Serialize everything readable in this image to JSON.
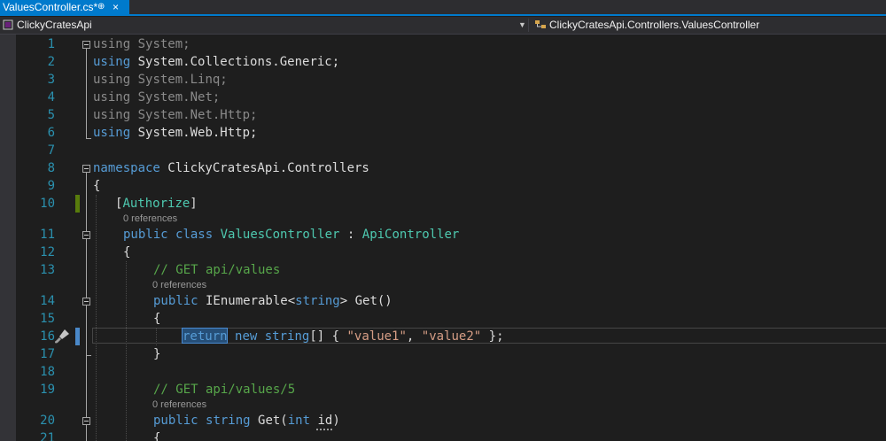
{
  "tab": {
    "title": "ValuesController.cs*",
    "pin": "⊕",
    "close": "×"
  },
  "navbar": {
    "project": "ClickyCratesApi",
    "type": "ClickyCratesApi.Controllers.ValuesController",
    "project_icon": "csharp-project-icon",
    "type_icon": "class-icon"
  },
  "colors": {
    "accent": "#007acc",
    "keyword": "#569cd6",
    "type": "#4ec9b0",
    "string": "#d69d85",
    "comment": "#57a64a",
    "line_number": "#2b91af"
  },
  "editor": {
    "line_numbers": [
      "1",
      "2",
      "3",
      "4",
      "5",
      "6",
      "7",
      "8",
      "9",
      "10",
      "11",
      "12",
      "13",
      "14",
      "15",
      "16",
      "17",
      "18",
      "19",
      "20",
      "21"
    ],
    "codelens": "0 references",
    "lines": {
      "l1": {
        "k": "using",
        "r": " System;"
      },
      "l2": {
        "k": "using",
        "r": " System.Collections.Generic;"
      },
      "l3": {
        "k": "using",
        "r": " System.Linq;"
      },
      "l4": {
        "k": "using",
        "r": " System.Net;"
      },
      "l5": {
        "k": "using",
        "r": " System.Net.Http;"
      },
      "l6": {
        "k": "using",
        "r": " System.Web.Http;"
      },
      "l8": {
        "k": "namespace",
        "r": " ClickyCratesApi.Controllers"
      },
      "l9": {
        "t": "{"
      },
      "l10": {
        "a": "[",
        "b": "Authorize",
        "c": "]"
      },
      "l11": {
        "a": "public",
        "b": " ",
        "c": "class",
        "d": " ",
        "e": "ValuesController",
        "f": " : ",
        "g": "ApiController"
      },
      "l12": {
        "t": "{"
      },
      "l13": {
        "t": "// GET api/values"
      },
      "l14": {
        "a": "public",
        "b": " IEnumerable<",
        "c": "string",
        "d": "> Get()"
      },
      "l15": {
        "t": "{"
      },
      "l16": {
        "a": "return",
        "b": " ",
        "c": "new",
        "d": " ",
        "e": "string",
        "f": "[] { ",
        "g": "\"value1\"",
        "h": ", ",
        "i": "\"value2\"",
        "j": " };"
      },
      "l17": {
        "t": "}"
      },
      "l19": {
        "t": "// GET api/values/5"
      },
      "l20": {
        "a": "public",
        "b": " ",
        "c": "string",
        "d": " Get(",
        "e": "int",
        "f": " ",
        "g": "id",
        "h": ")"
      },
      "l21": {
        "t": "{"
      }
    }
  }
}
